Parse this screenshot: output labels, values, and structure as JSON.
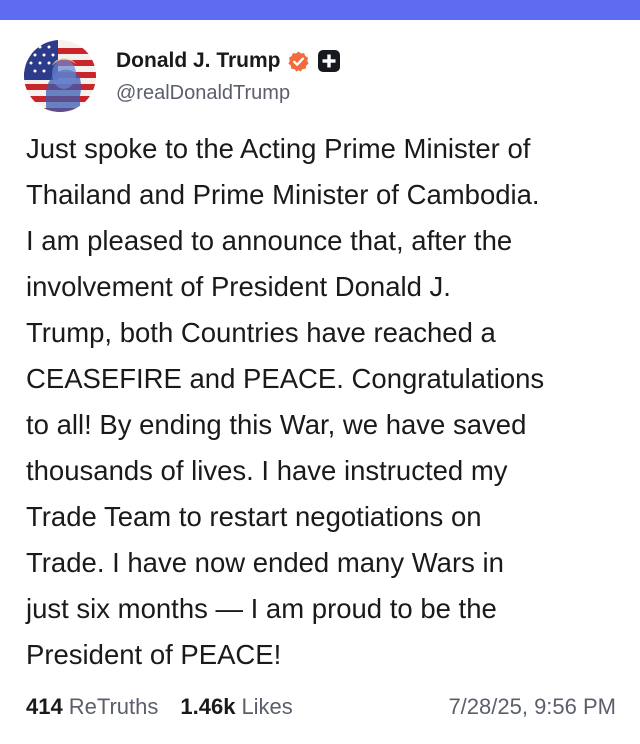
{
  "colors": {
    "top_bar": "#5d6cf0",
    "verified": "#f26b3a",
    "text": "#1a1a1a",
    "muted": "#5a5f6b"
  },
  "author": {
    "display_name": "Donald J. Trump",
    "handle": "@realDonaldTrump",
    "avatar_icon": "american-flag-portrait-avatar",
    "verified_icon": "verified-badge-icon",
    "plus_icon": "plus-badge-icon"
  },
  "post": {
    "lines": [
      "Just spoke to the Acting Prime Minister of",
      "Thailand and Prime Minister of Cambodia.",
      "I am pleased to announce that, after the",
      "involvement of President Donald J.",
      "Trump, both Countries have reached a",
      "CEASEFIRE and PEACE. Congratulations",
      "to all! By ending this War, we have saved",
      "thousands of lives. I have instructed my",
      "Trade Team to restart negotiations on",
      "Trade. I have now ended many Wars in",
      "just six months — I am proud to be the",
      "President of PEACE!"
    ]
  },
  "stats": {
    "retruths_count": "414",
    "retruths_label": "ReTruths",
    "likes_count": "1.46k",
    "likes_label": "Likes",
    "timestamp": "7/28/25, 9:56 PM"
  }
}
